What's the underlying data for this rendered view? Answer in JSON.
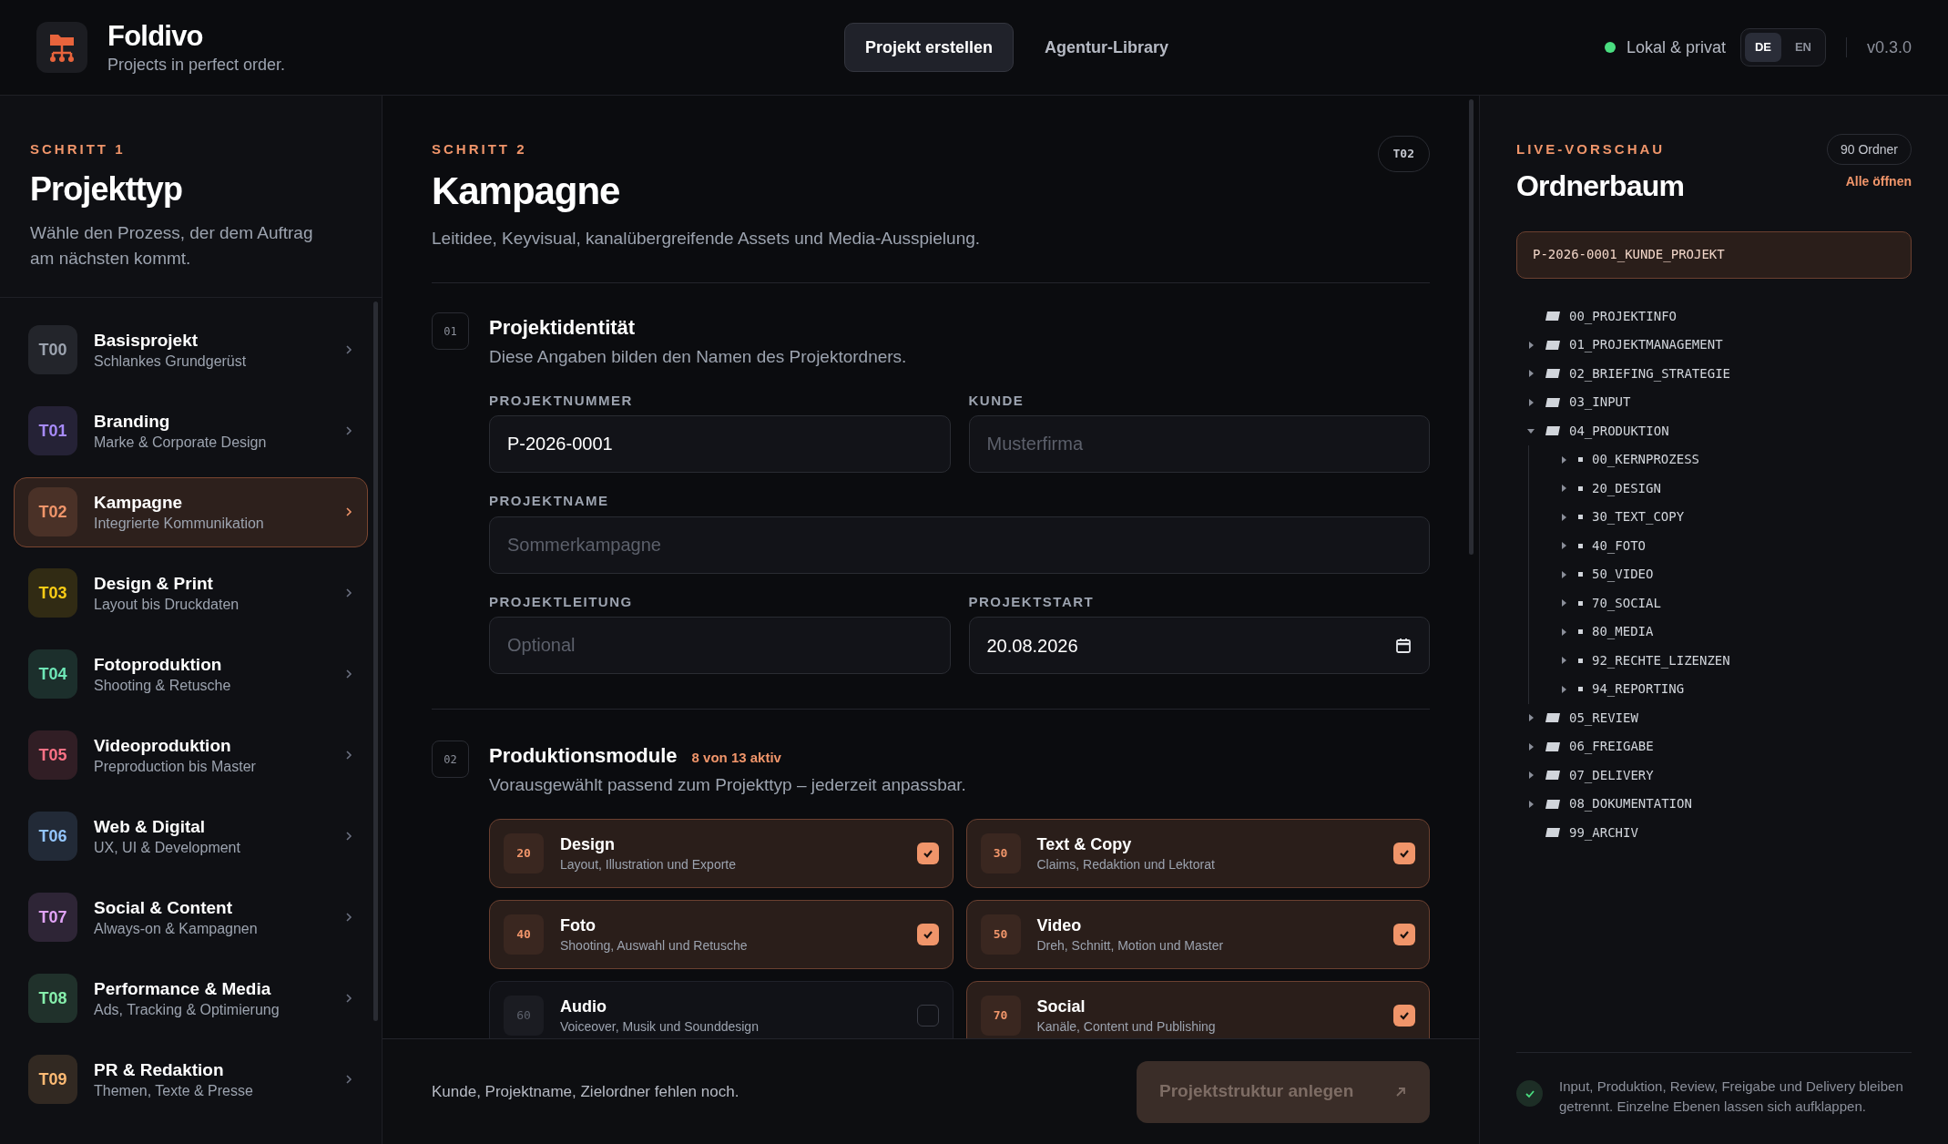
{
  "header": {
    "app_name": "Foldivo",
    "tagline": "Projects in perfect order.",
    "nav": [
      {
        "label": "Projekt erstellen",
        "selected": true
      },
      {
        "label": "Agentur-Library",
        "selected": false
      }
    ],
    "status": {
      "label": "Lokal & privat",
      "color": "#4ade80"
    },
    "languages": [
      {
        "label": "DE",
        "selected": true
      },
      {
        "label": "EN",
        "selected": false
      }
    ],
    "version": "v0.3.0"
  },
  "sidebar": {
    "step": "SCHRITT 1",
    "title": "Projekttyp",
    "description": "Wähle den Prozess, der dem Auftrag am nächsten kommt.",
    "items": [
      {
        "code": "T00",
        "title": "Basisprojekt",
        "subtitle": "Schlankes Grundgerüst",
        "color": "#9ca3af",
        "selected": false
      },
      {
        "code": "T01",
        "title": "Branding",
        "subtitle": "Marke & Corporate Design",
        "color": "#a78bfa",
        "selected": false
      },
      {
        "code": "T02",
        "title": "Kampagne",
        "subtitle": "Integrierte Kommunikation",
        "color": "#f0956a",
        "selected": true
      },
      {
        "code": "T03",
        "title": "Design & Print",
        "subtitle": "Layout bis Druckdaten",
        "color": "#facc15",
        "selected": false
      },
      {
        "code": "T04",
        "title": "Fotoproduktion",
        "subtitle": "Shooting & Retusche",
        "color": "#6ee7b7",
        "selected": false
      },
      {
        "code": "T05",
        "title": "Videoproduktion",
        "subtitle": "Preproduction bis Master",
        "color": "#fb7185",
        "selected": false
      },
      {
        "code": "T06",
        "title": "Web & Digital",
        "subtitle": "UX, UI & Development",
        "color": "#93c5fd",
        "selected": false
      },
      {
        "code": "T07",
        "title": "Social & Content",
        "subtitle": "Always-on & Kampagnen",
        "color": "#e1a3f7",
        "selected": false
      },
      {
        "code": "T08",
        "title": "Performance & Media",
        "subtitle": "Ads, Tracking & Optimierung",
        "color": "#86efac",
        "selected": false
      },
      {
        "code": "T09",
        "title": "PR & Redaktion",
        "subtitle": "Themen, Texte & Presse",
        "color": "#fdba74",
        "selected": false
      }
    ]
  },
  "main": {
    "step": "SCHRITT 2",
    "badge": "T02",
    "title": "Kampagne",
    "description": "Leitidee, Keyvisual, kanalübergreifende Assets und Media-Ausspielung.",
    "identity": {
      "number": "01",
      "title": "Projektidentität",
      "description": "Diese Angaben bilden den Namen des Projektordners.",
      "fields": [
        {
          "label": "PROJEKTNUMMER",
          "value": "P-2026-0001",
          "kind": "text"
        },
        {
          "label": "KUNDE",
          "placeholder": "Musterfirma",
          "kind": "text"
        },
        {
          "label": "PROJEKTNAME",
          "placeholder": "Sommerkampagne",
          "kind": "wide"
        },
        {
          "label": "PROJEKTLEITUNG",
          "placeholder": "Optional",
          "kind": "text"
        },
        {
          "label": "PROJEKTSTART",
          "value": "20.08.2026",
          "kind": "date"
        }
      ]
    },
    "modules": {
      "number": "02",
      "title": "Produktionsmodule",
      "count": "8 von 13 aktiv",
      "description": "Vorausgewählt passend zum Projekttyp – jederzeit anpassbar.",
      "items": [
        {
          "code": "20",
          "title": "Design",
          "subtitle": "Layout, Illustration und Exporte",
          "checked": true
        },
        {
          "code": "30",
          "title": "Text & Copy",
          "subtitle": "Claims, Redaktion und Lektorat",
          "checked": true
        },
        {
          "code": "40",
          "title": "Foto",
          "subtitle": "Shooting, Auswahl und Retusche",
          "checked": true
        },
        {
          "code": "50",
          "title": "Video",
          "subtitle": "Dreh, Schnitt, Motion und Master",
          "checked": true
        },
        {
          "code": "60",
          "title": "Audio",
          "subtitle": "Voiceover, Musik und Sounddesign",
          "checked": false
        },
        {
          "code": "70",
          "title": "Social",
          "subtitle": "Kanäle, Content und Publishing",
          "checked": true
        }
      ]
    },
    "footer": {
      "message": "Kunde, Projektname, Zielordner fehlen noch.",
      "button": {
        "label": "Projektstruktur anlegen",
        "disabled": true
      }
    }
  },
  "preview": {
    "step": "LIVE-VORSCHAU",
    "title": "Ordnerbaum",
    "count": "90 Ordner",
    "action": "Alle öffnen",
    "root": "P-2026-0001_KUNDE_PROJEKT",
    "tree": [
      {
        "name": "00_PROJEKTINFO",
        "expandable": false
      },
      {
        "name": "01_PROJEKTMANAGEMENT",
        "expandable": true,
        "expanded": false
      },
      {
        "name": "02_BRIEFING_STRATEGIE",
        "expandable": true,
        "expanded": false
      },
      {
        "name": "03_INPUT",
        "expandable": true,
        "expanded": false
      },
      {
        "name": "04_PRODUKTION",
        "expandable": true,
        "expanded": true,
        "children": [
          {
            "name": "00_KERNPROZESS",
            "expandable": true,
            "expanded": false
          },
          {
            "name": "20_DESIGN",
            "expandable": true,
            "expanded": false
          },
          {
            "name": "30_TEXT_COPY",
            "expandable": true,
            "expanded": false
          },
          {
            "name": "40_FOTO",
            "expandable": true,
            "expanded": false
          },
          {
            "name": "50_VIDEO",
            "expandable": true,
            "expanded": false
          },
          {
            "name": "70_SOCIAL",
            "expandable": true,
            "expanded": false
          },
          {
            "name": "80_MEDIA",
            "expandable": true,
            "expanded": false
          },
          {
            "name": "92_RECHTE_LIZENZEN",
            "expandable": true,
            "expanded": false
          },
          {
            "name": "94_REPORTING",
            "expandable": true,
            "expanded": false
          }
        ]
      },
      {
        "name": "05_REVIEW",
        "expandable": true,
        "expanded": false
      },
      {
        "name": "06_FREIGABE",
        "expandable": true,
        "expanded": false
      },
      {
        "name": "07_DELIVERY",
        "expandable": true,
        "expanded": false
      },
      {
        "name": "08_DOKUMENTATION",
        "expandable": true,
        "expanded": false
      },
      {
        "name": "99_ARCHIV",
        "expandable": false
      }
    ],
    "note": "Input, Produktion, Review, Freigabe und Delivery bleiben getrennt. Einzelne Ebenen lassen sich aufklappen."
  }
}
